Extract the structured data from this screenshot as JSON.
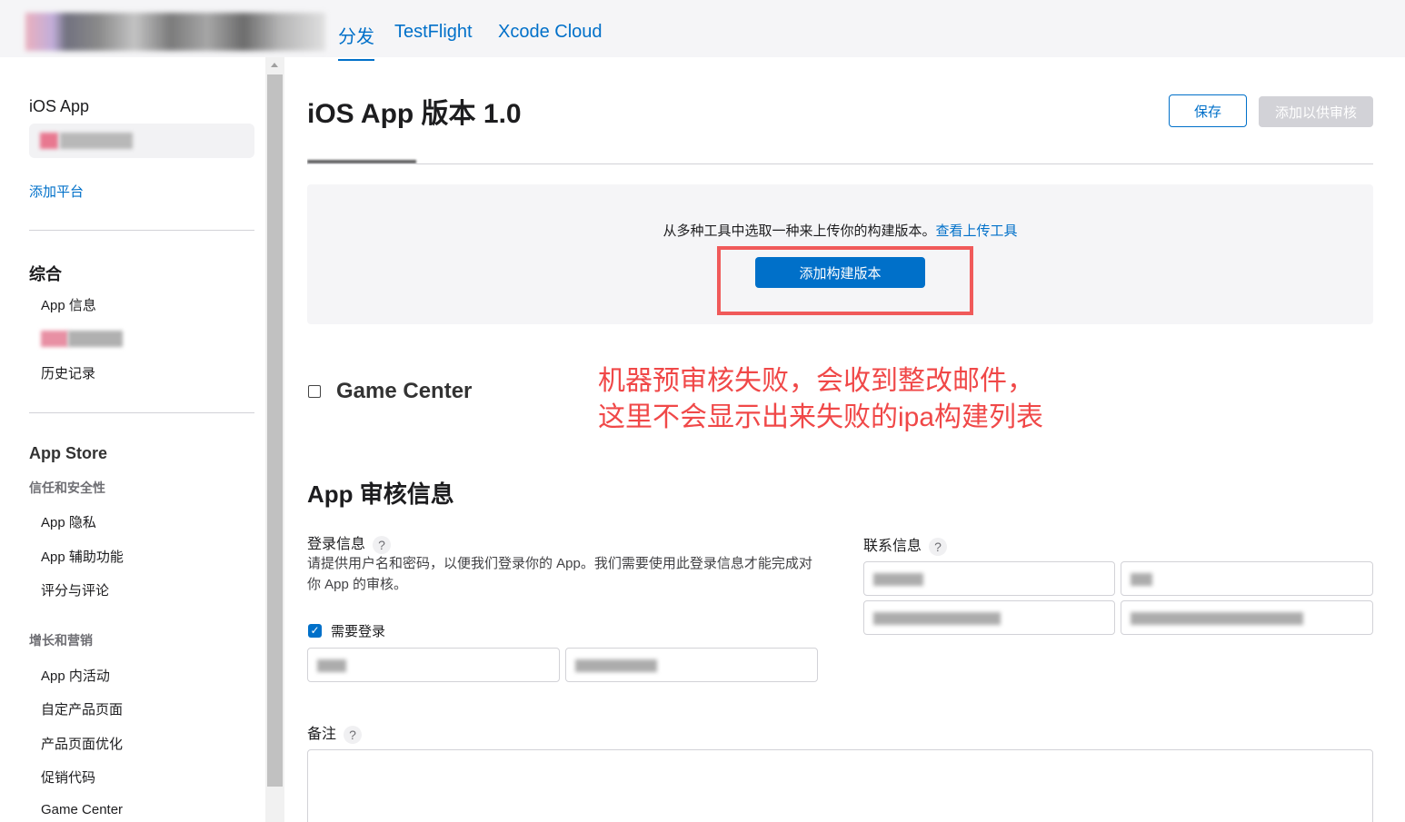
{
  "topnav": {
    "tabs": [
      {
        "label": "分发",
        "active": true
      },
      {
        "label": "TestFlight",
        "active": false
      },
      {
        "label": "Xcode Cloud",
        "active": false
      }
    ]
  },
  "sidebar": {
    "platform_heading": "iOS App",
    "add_platform": "添加平台",
    "general_heading": "综合",
    "general_items": [
      "App 信息",
      "历史记录"
    ],
    "appstore_heading": "App Store",
    "trust_heading": "信任和安全性",
    "trust_items": [
      "App 隐私",
      "App 辅助功能",
      "评分与评论"
    ],
    "growth_heading": "增长和营销",
    "growth_items": [
      "App 内活动",
      "自定产品页面",
      "产品页面优化",
      "促销代码",
      "Game Center"
    ]
  },
  "main": {
    "title": "iOS App 版本 1.0",
    "save_label": "保存",
    "submit_label": "添加以供审核",
    "build": {
      "hint": "从多种工具中选取一种来上传你的构建版本。",
      "hint_link": "查看上传工具",
      "add_build_label": "添加构建版本"
    },
    "game_center_label": "Game Center",
    "annotation_line1": "机器预审核失败，会收到整改邮件，",
    "annotation_line2": "这里不会显示出来失败的ipa构建列表",
    "review_section_title": "App 审核信息",
    "login_label": "登录信息",
    "login_desc": "请提供用户名和密码，以便我们登录你的 App。我们需要使用此登录信息才能完成对你 App 的审核。",
    "need_login_label": "需要登录",
    "contact_label": "联系信息",
    "notes_label": "备注",
    "help_glyph": "?"
  },
  "colors": {
    "accent": "#0070c9",
    "annotation": "#f04848",
    "disabled_button": "#d2d2d7"
  }
}
